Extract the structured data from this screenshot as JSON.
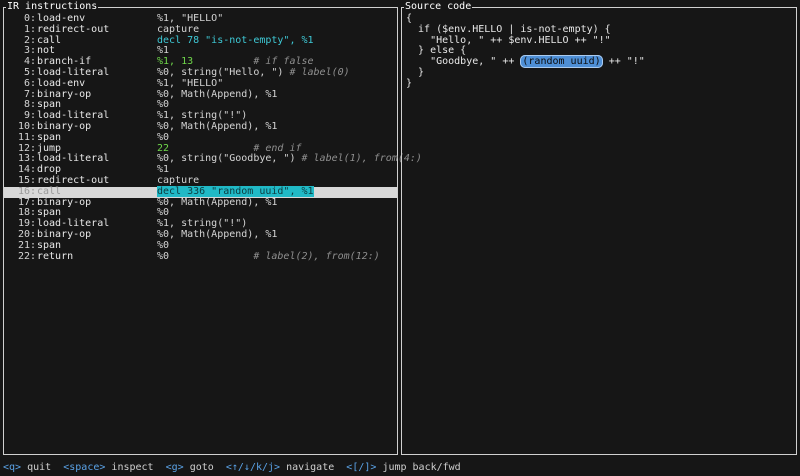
{
  "ir_pane": {
    "title": "IR instructions",
    "rows": [
      {
        "idx": "0:",
        "op": "load-env",
        "args": [
          {
            "t": "%1, \"HELLO\"",
            "c": "plain"
          }
        ]
      },
      {
        "idx": "1:",
        "op": "redirect-out",
        "args": [
          {
            "t": "capture",
            "c": "plain"
          }
        ]
      },
      {
        "idx": "2:",
        "op": "call",
        "args": [
          {
            "t": "decl 78 \"is-not-empty\", %1",
            "c": "cyan"
          }
        ]
      },
      {
        "idx": "3:",
        "op": "not",
        "args": [
          {
            "t": "%1",
            "c": "plain"
          }
        ]
      },
      {
        "idx": "4:",
        "op": "branch-if",
        "args": [
          {
            "t": "%1, 13",
            "c": "green"
          },
          {
            "t": "          # if false",
            "c": "comment"
          }
        ]
      },
      {
        "idx": "5:",
        "op": "load-literal",
        "args": [
          {
            "t": "%0, string(\"Hello, \") ",
            "c": "plain"
          },
          {
            "t": "# label(0)",
            "c": "comment"
          }
        ]
      },
      {
        "idx": "6:",
        "op": "load-env",
        "args": [
          {
            "t": "%1, \"HELLO\"",
            "c": "plain"
          }
        ]
      },
      {
        "idx": "7:",
        "op": "binary-op",
        "args": [
          {
            "t": "%0, Math(Append), %1",
            "c": "plain"
          }
        ]
      },
      {
        "idx": "8:",
        "op": "span",
        "args": [
          {
            "t": "%0",
            "c": "plain"
          }
        ]
      },
      {
        "idx": "9:",
        "op": "load-literal",
        "args": [
          {
            "t": "%1, string(\"!\")",
            "c": "plain"
          }
        ]
      },
      {
        "idx": "10:",
        "op": "binary-op",
        "args": [
          {
            "t": "%0, Math(Append), %1",
            "c": "plain"
          }
        ]
      },
      {
        "idx": "11:",
        "op": "span",
        "args": [
          {
            "t": "%0",
            "c": "plain"
          }
        ]
      },
      {
        "idx": "12:",
        "op": "jump",
        "args": [
          {
            "t": "22",
            "c": "green"
          },
          {
            "t": "              # end if",
            "c": "comment"
          }
        ]
      },
      {
        "idx": "13:",
        "op": "load-literal",
        "args": [
          {
            "t": "%0, string(\"Goodbye, \") ",
            "c": "plain"
          },
          {
            "t": "# label(1), from(4:)",
            "c": "comment"
          }
        ]
      },
      {
        "idx": "14:",
        "op": "drop",
        "args": [
          {
            "t": "%1",
            "c": "plain"
          }
        ]
      },
      {
        "idx": "15:",
        "op": "redirect-out",
        "args": [
          {
            "t": "capture",
            "c": "plain"
          }
        ]
      },
      {
        "idx": "16:",
        "op": "call",
        "selected": true,
        "args": [
          {
            "t": "decl 336 \"random uuid\", %1",
            "c": "hl"
          }
        ]
      },
      {
        "idx": "17:",
        "op": "binary-op",
        "args": [
          {
            "t": "%0, Math(Append), %1",
            "c": "plain"
          }
        ]
      },
      {
        "idx": "18:",
        "op": "span",
        "args": [
          {
            "t": "%0",
            "c": "plain"
          }
        ]
      },
      {
        "idx": "19:",
        "op": "load-literal",
        "args": [
          {
            "t": "%1, string(\"!\")",
            "c": "plain"
          }
        ]
      },
      {
        "idx": "20:",
        "op": "binary-op",
        "args": [
          {
            "t": "%0, Math(Append), %1",
            "c": "plain"
          }
        ]
      },
      {
        "idx": "21:",
        "op": "span",
        "args": [
          {
            "t": "%0",
            "c": "plain"
          }
        ]
      },
      {
        "idx": "22:",
        "op": "return",
        "args": [
          {
            "t": "%0",
            "c": "plain"
          },
          {
            "t": "              # label(2), from(12:)",
            "c": "comment"
          }
        ]
      }
    ]
  },
  "source_pane": {
    "title": "Source code",
    "lines": [
      {
        "pre": "{"
      },
      {
        "pre": "  if ($env.HELLO | is-not-empty) {"
      },
      {
        "pre": "    \"Hello, \" ++ $env.HELLO ++ \"!\""
      },
      {
        "pre": "  } else {"
      },
      {
        "pre": "    \"Goodbye, \" ++ ",
        "mark": "(random uuid)",
        "post": " ++ \"!\""
      },
      {
        "pre": "  }"
      },
      {
        "pre": "}"
      }
    ]
  },
  "footer": [
    {
      "key": "<q>",
      "desc": "quit"
    },
    {
      "key": "<space>",
      "desc": "inspect"
    },
    {
      "key": "<g>",
      "desc": "goto"
    },
    {
      "key": "<↑/↓/k/j>",
      "desc": "navigate"
    },
    {
      "key": "<[/]>",
      "desc": "jump back/fwd"
    }
  ],
  "colors": {
    "background": "#161616",
    "text": "#d4d4d4",
    "green": "#6fd64a",
    "cyan": "#3ec9d6",
    "highlight": "#20b9c6",
    "selected_row": "#d8d8d8",
    "key": "#5aa2e6",
    "source_mark": "#4e8fd6"
  }
}
